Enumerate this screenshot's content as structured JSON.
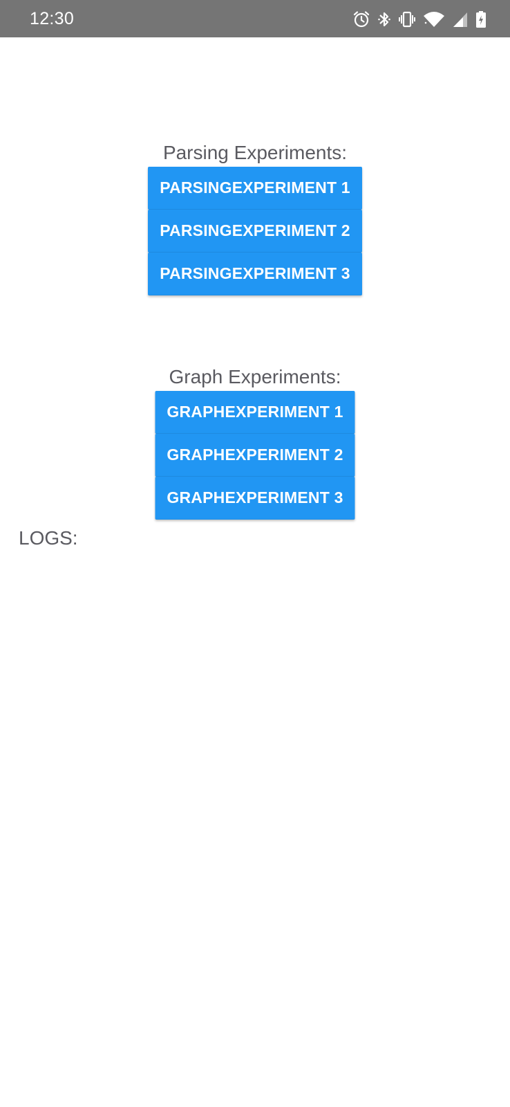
{
  "status_bar": {
    "time": "12:30",
    "icons": [
      "alarm-icon",
      "bluetooth-icon",
      "vibrate-icon",
      "wifi-icon",
      "cell-signal-icon",
      "battery-charging-icon"
    ]
  },
  "parsing": {
    "title": "Parsing Experiments:",
    "buttons": [
      "PARSINGEXPERIMENT 1",
      "PARSINGEXPERIMENT 2",
      "PARSINGEXPERIMENT 3"
    ]
  },
  "graph": {
    "title": "Graph Experiments:",
    "buttons": [
      "GRAPHEXPERIMENT 1",
      "GRAPHEXPERIMENT 2",
      "GRAPHEXPERIMENT 3"
    ]
  },
  "logs": {
    "label": "LOGS:"
  },
  "colors": {
    "status_bar": "#757575",
    "button": "#2196f3",
    "text": "#5a5a60",
    "background": "#ffffff"
  }
}
